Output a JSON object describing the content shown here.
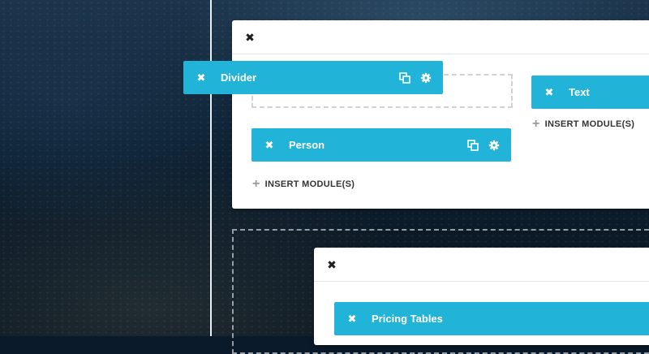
{
  "close_glyph": "✖",
  "plus_glyph": "+",
  "colors": {
    "module_blue": "#22b3d9",
    "panel_white": "#ffffff"
  },
  "floating_module": {
    "label": "Divider"
  },
  "column_left": {
    "module": {
      "label": "Person"
    },
    "insert_label": "INSERT MODULE(S)"
  },
  "column_right": {
    "module": {
      "label": "Text"
    },
    "insert_label": "INSERT MODULE(S)"
  },
  "lower_section": {
    "module": {
      "label": "Pricing Tables"
    }
  },
  "icons": [
    "close-icon",
    "copy-icon",
    "settings-gear-icon",
    "plus-icon"
  ]
}
